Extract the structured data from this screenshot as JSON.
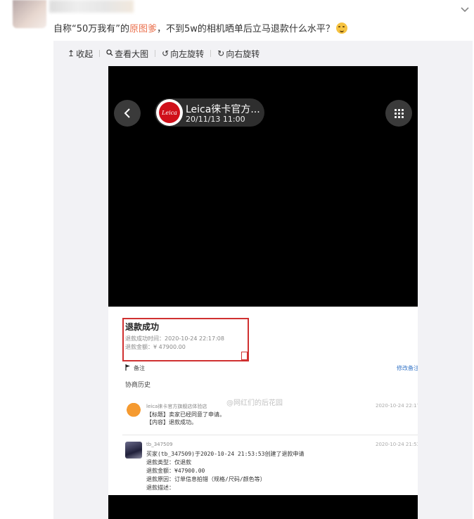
{
  "post": {
    "text_before": "自称“50万我有”的",
    "link_text": "原图爹",
    "text_after": "，不到5w的相机晒单后立马退款什么水平？",
    "emoji": "doge-face",
    "chevron_icon": "chevron-down-icon"
  },
  "toolbar": {
    "items": [
      {
        "icon": "↥",
        "label": "收起"
      },
      {
        "icon": "🔍",
        "label": "查看大图"
      },
      {
        "icon": "↺",
        "label": "向左旋转"
      },
      {
        "icon": "↻",
        "label": "向右旋转"
      }
    ]
  },
  "screenshot": {
    "shop_name": "Leica徕卡官方...",
    "shop_time": "20/11/13 11:00",
    "logo_text": "Leica",
    "refund": {
      "title": "退款成功",
      "time": "退款成功时间：2020-10-24 22:17:08",
      "amount": "退款金额：¥ 47900.00"
    },
    "note_label": "备注",
    "edit_note": "修改备注",
    "history_title": "协商历史",
    "watermark": "@网红们的后花园",
    "message1": {
      "sender": "leica徕卡官方旗舰店体验店",
      "date": "2020-10-24 22:17:08",
      "line1": "【标题】卖家已经同意了申请。",
      "line2": "【内容】退款成功。"
    },
    "message2": {
      "sender": "tb_347509",
      "date": "2020-10-24 21:53:53",
      "lines": [
        "买家(tb_347509)于2020-10-24 21:53:53创建了退款申请",
        "退款类型：仅退款",
        "退款金额：¥47900.00",
        "退款原因：订单信息拍错（规格/尺码/颜色等）",
        "退款描述："
      ]
    }
  },
  "colors": {
    "link": "#eb7350",
    "panel_bg": "#f2f2f5",
    "refund_border": "#d03030",
    "edit_link": "#3a78c8"
  }
}
